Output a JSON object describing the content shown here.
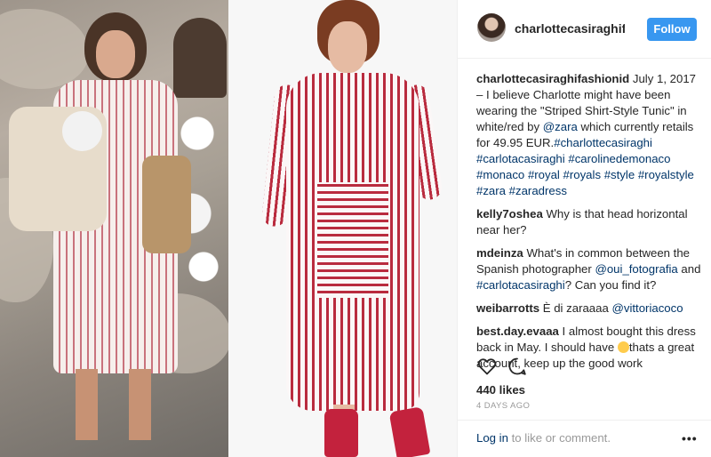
{
  "post": {
    "username": "charlottecasiraghifashionid",
    "follow_label": "Follow",
    "caption_user": "charlottecasiraghifashionid",
    "caption_text_1": " July 1, 2017 – I believe Charlotte might have been wearing the \"Striped Shirt-Style Tunic\" in white/red by ",
    "caption_mention": "@zara",
    "caption_text_2": " which currently retails for 49.95 EUR.",
    "hashtags": [
      "#charlottecasiraghi",
      "#carlotacasiraghi",
      "#carolinedemonaco",
      "#monaco",
      "#royal",
      "#royals",
      "#style",
      "#royalstyle",
      "#zara",
      "#zaradress"
    ]
  },
  "comments": [
    {
      "user": "kelly7oshea",
      "text": "Why is that head horizontal near her?"
    },
    {
      "user": "mdeinza",
      "text_1": "What's in common between the Spanish photographer ",
      "mention_1": "@oui_fotografia",
      "text_2": " and ",
      "mention_2": "#carlotacasiraghi",
      "text_3": "? Can you find it?"
    },
    {
      "user": "weibarrotts",
      "text": "È di zaraaaa ",
      "mention": "@vittoriacoco"
    },
    {
      "user": "best.day.evaaa",
      "text_1": "I almost bought this dress back in May. I should have ",
      "text_2": "thats a great account, keep up the good work"
    }
  ],
  "likes_label": "440 likes",
  "timestamp": "4 DAYS AGO",
  "footer": {
    "login_link": "Log in",
    "login_text": " to like or comment.",
    "more": "•••"
  },
  "colors": {
    "follow": "#3897f0",
    "link": "#003569",
    "muted": "#999999"
  }
}
